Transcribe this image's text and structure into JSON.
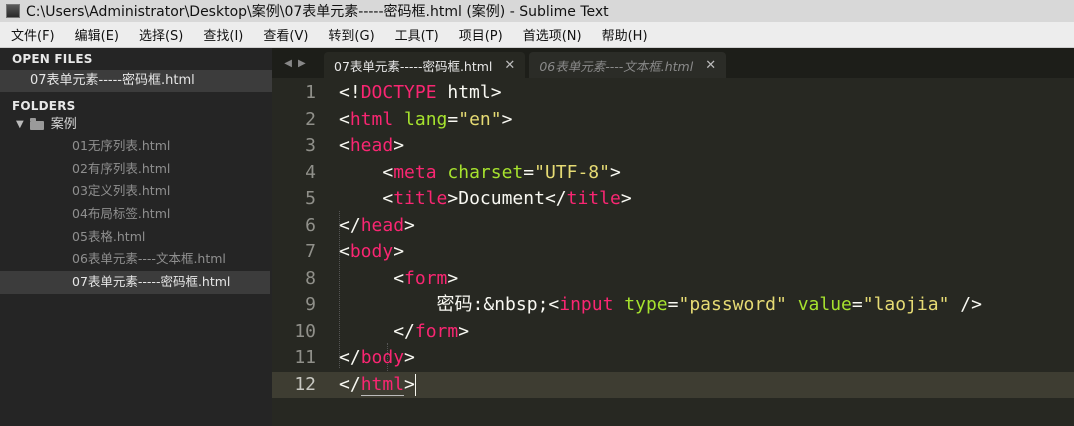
{
  "window": {
    "title": "C:\\Users\\Administrator\\Desktop\\案例\\07表单元素-----密码框.html (案例) - Sublime Text"
  },
  "menu": [
    "文件(F)",
    "编辑(E)",
    "选择(S)",
    "查找(I)",
    "查看(V)",
    "转到(G)",
    "工具(T)",
    "项目(P)",
    "首选项(N)",
    "帮助(H)"
  ],
  "sidebar": {
    "open_files_header": "OPEN FILES",
    "open_file": "07表单元素-----密码框.html",
    "folders_header": "FOLDERS",
    "folder_name": "案例",
    "files": [
      "01无序列表.html",
      "02有序列表.html",
      "03定义列表.html",
      "04布局标签.html",
      "05表格.html",
      "06表单元素----文本框.html",
      "07表单元素-----密码框.html"
    ],
    "active_file_index": 6
  },
  "tabs": [
    {
      "label": "07表单元素-----密码框.html",
      "close": "✕",
      "active": true
    },
    {
      "label": "06表单元素----文本框.html",
      "close": "✕",
      "active": false
    }
  ],
  "tab_nav": {
    "left": "◀",
    "right": "▶"
  },
  "editor": {
    "line_numbers": [
      "1",
      "2",
      "3",
      "4",
      "5",
      "6",
      "7",
      "8",
      "9",
      "10",
      "11",
      "12"
    ],
    "current_line": 12,
    "code": {
      "l1": {
        "open": "<!",
        "kw": "DOCTYPE",
        "rest": " html>"
      },
      "l2": {
        "lt": "<",
        "tag": "html",
        "attr": "lang",
        "eq": "=",
        "val": "\"en\"",
        "gt": ">"
      },
      "l3": {
        "lt": "<",
        "tag": "head",
        "gt": ">"
      },
      "l4": {
        "lt": "<",
        "tag": "meta",
        "attr": "charset",
        "eq": "=",
        "val": "\"UTF-8\"",
        "gt": ">"
      },
      "l5": {
        "lt": "<",
        "tag": "title",
        "gt": ">",
        "text": "Document",
        "clt": "</",
        "ctag": "title",
        "cgt": ">"
      },
      "l6": {
        "lt": "</",
        "tag": "head",
        "gt": ">"
      },
      "l7": {
        "lt": "<",
        "tag": "body",
        "gt": ">"
      },
      "l8": {
        "lt": "<",
        "tag": "form",
        "gt": ">"
      },
      "l9": {
        "text": "密码:&nbsp;",
        "lt": "<",
        "tag": "input",
        "attr1": "type",
        "eq1": "=",
        "val1": "\"password\"",
        "attr2": "value",
        "eq2": "=",
        "val2": "\"laojia\"",
        "end": " />"
      },
      "l10": {
        "lt": "</",
        "tag": "form",
        "gt": ">"
      },
      "l11": {
        "lt": "</",
        "tag": "body",
        "gt": ">"
      },
      "l12": {
        "lt": "</",
        "tag": "html",
        "gt": ">"
      }
    }
  },
  "colors": {
    "background": "#272822",
    "tag": "#f92672",
    "attribute": "#a6e22e",
    "string": "#e6db74",
    "text": "#f8f8f2"
  }
}
